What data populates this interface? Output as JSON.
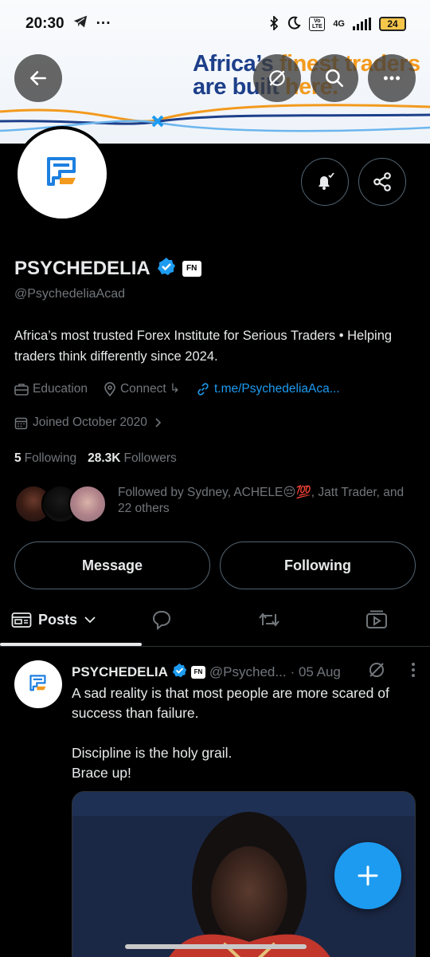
{
  "status_bar": {
    "time": "20:30",
    "network": "4G",
    "volte": "Vo LTE",
    "battery": "24"
  },
  "banner": {
    "line1_a": "Africa’s ",
    "line1_b": "finest traders",
    "line2_a": "are built ",
    "line2_b": "here."
  },
  "profile": {
    "name": "PSYCHEDELIA",
    "badge": "FN",
    "handle": "@PsychedeliaAcad",
    "bio": "Africa’s most trusted Forex Institute for Serious Traders • Helping traders think differently since 2024.",
    "category": "Education",
    "location": "Connect ↳",
    "website": "t.me/PsychedeliaAca...",
    "joined": "Joined October 2020",
    "following_count": "5",
    "following_label": "Following",
    "followers_count": "28.3K",
    "followers_label": "Followers",
    "followed_by": "Followed by Sydney, ACHELE😔💯, Jatt Trader, and 22 others"
  },
  "actions": {
    "message": "Message",
    "following": "Following"
  },
  "tabs": {
    "posts": "Posts"
  },
  "tweet": {
    "name": "PSYCHEDELIA",
    "badge": "FN",
    "handle": "@Psyched...",
    "date": "· 05 Aug",
    "line1": "A sad reality is that most people are more scared of success than failure.",
    "line2": "Discipline is the holy grail.",
    "line3": "Brace up!"
  },
  "colors": {
    "accent": "#1d9bf0",
    "verified": "#1d9bf0",
    "brand_blue": "#1d3f8a",
    "brand_orange": "#f39a1e"
  }
}
